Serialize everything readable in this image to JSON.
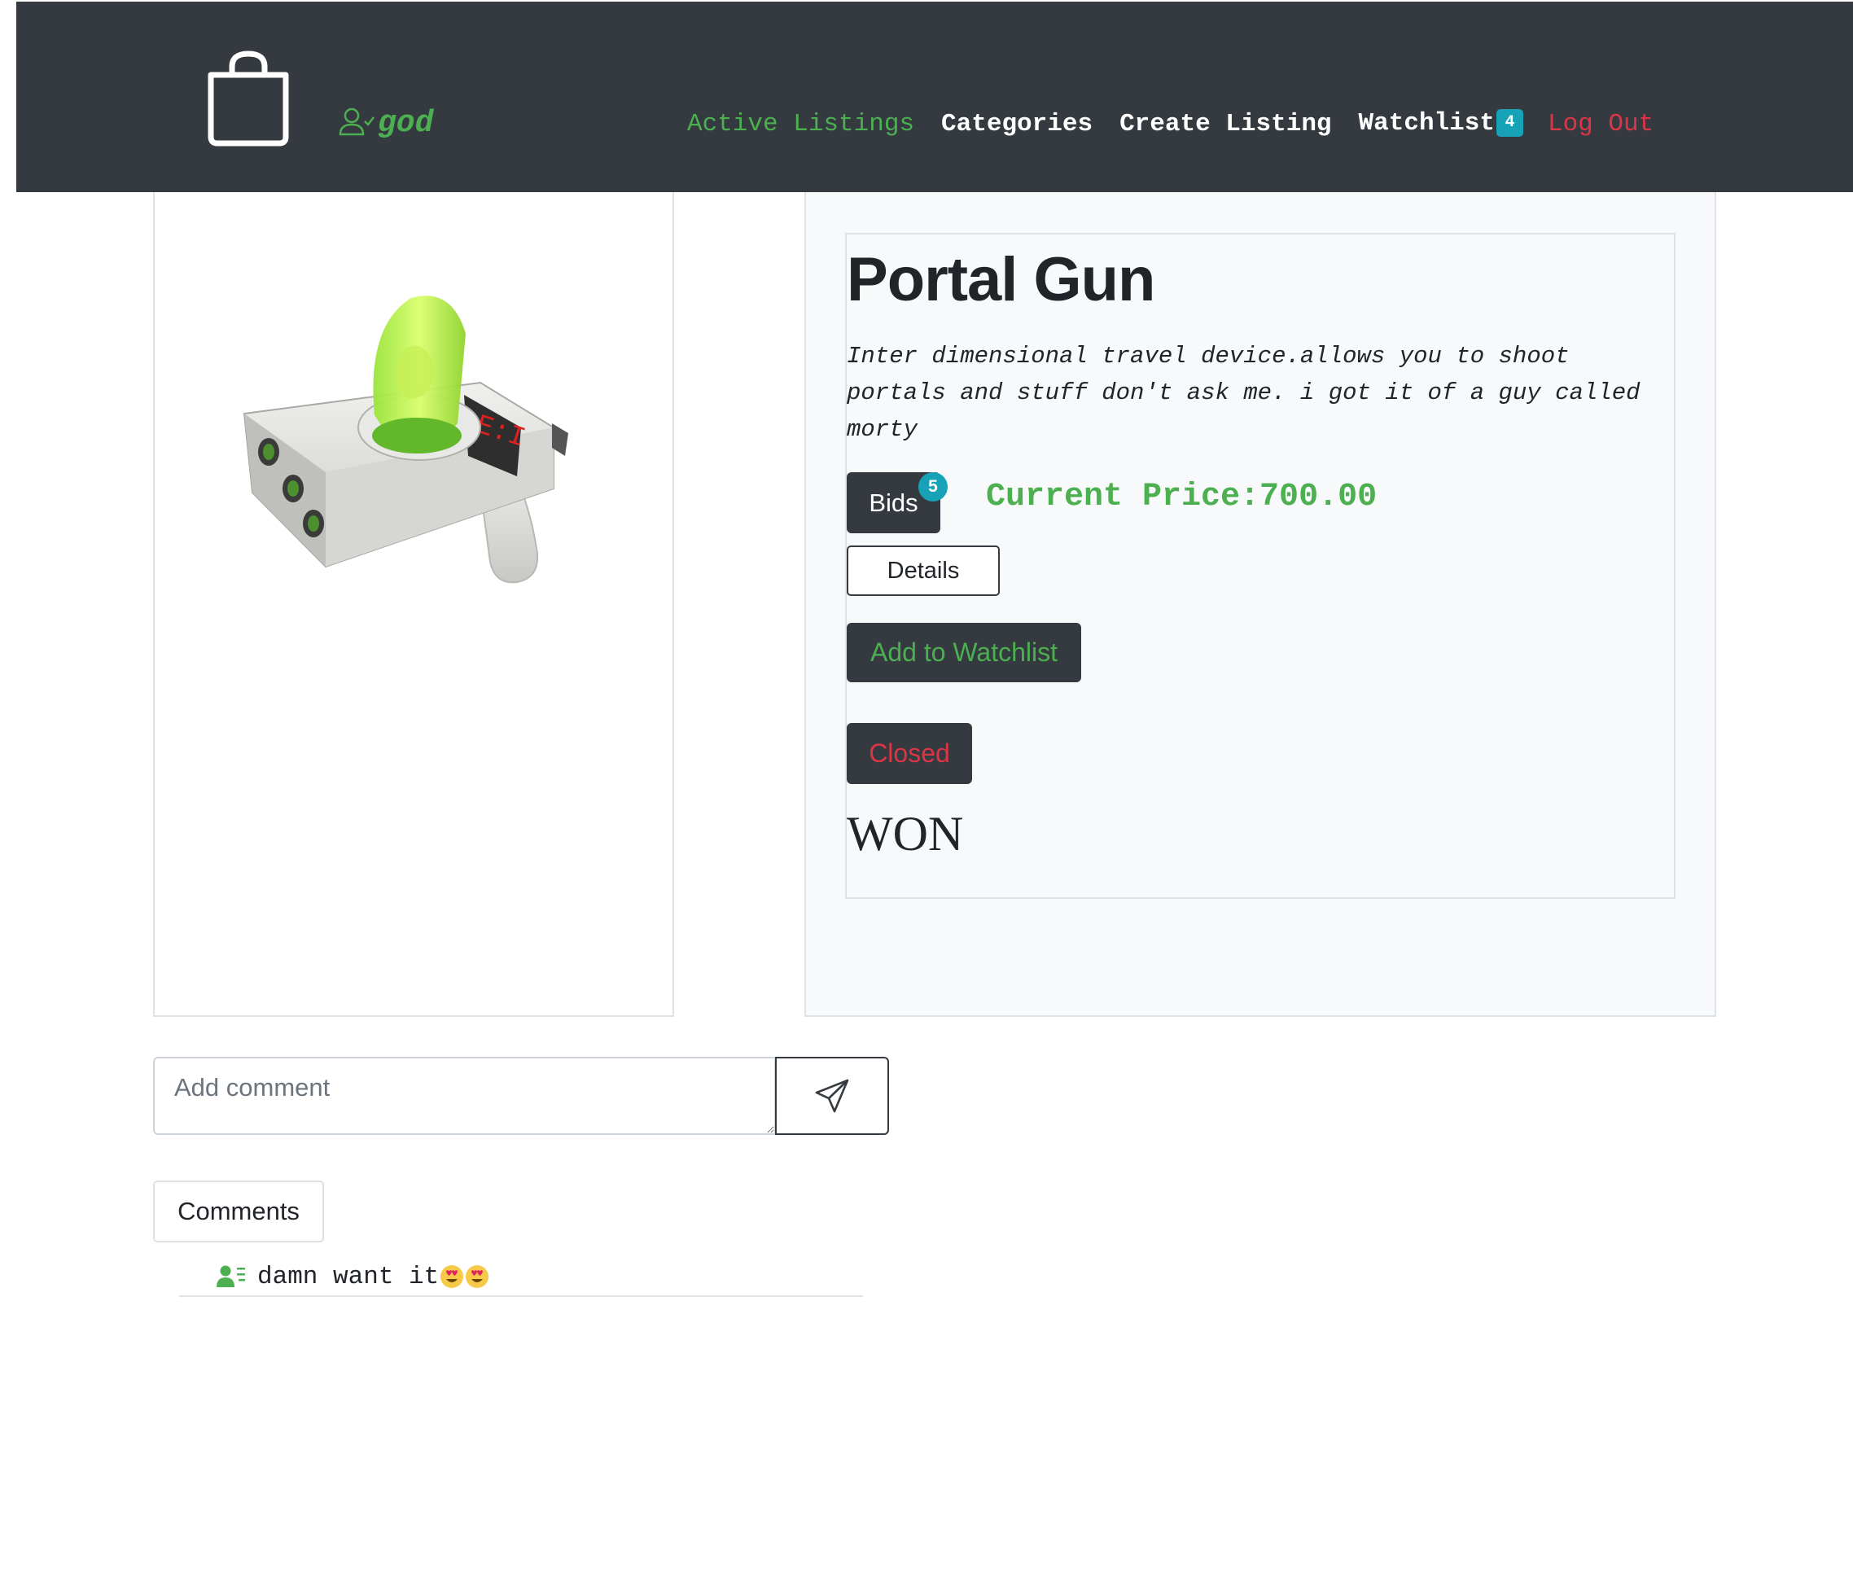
{
  "nav": {
    "username": "god",
    "links": {
      "active_listings": "Active Listings",
      "categories": "Categories",
      "create_listing": "Create Listing",
      "watchlist": "Watchlist",
      "watchlist_count": "4",
      "logout": "Log Out"
    },
    "colors": {
      "background": "#343a40",
      "active": "#4caf50",
      "logout": "#dc3545",
      "badge": "#17a2b8"
    }
  },
  "listing": {
    "title": "Portal Gun",
    "description": "Inter dimensional travel device.allows you to shoot portals and stuff don't ask me. i got it of a guy called morty",
    "bids_label": "Bids",
    "bids_count": "5",
    "price_text": "Current Price:700.00",
    "details_label": "Details",
    "watchlist_label": "Add to Watchlist",
    "status_label": "Closed",
    "result_text": "WON",
    "image_icon": "portal-gun-image"
  },
  "comments": {
    "input_placeholder": "Add comment",
    "send_icon": "send-icon",
    "tab_label": "Comments",
    "items": [
      {
        "text": "damn want it",
        "icon": "user-comment-icon",
        "emoji": "heart-eyes"
      }
    ]
  }
}
